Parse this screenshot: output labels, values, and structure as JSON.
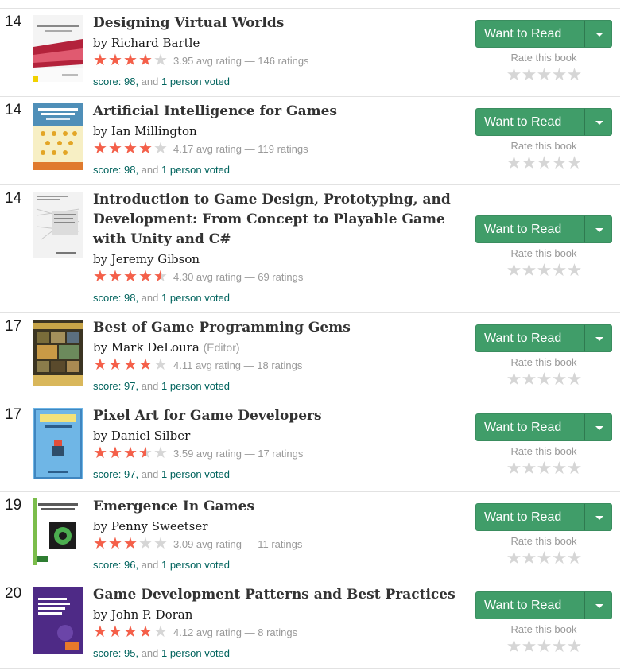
{
  "books": [
    {
      "rank": "14",
      "title": "Designing Virtual Worlds",
      "author": "Richard Bartle",
      "role": "",
      "stars": 3.95,
      "minirating": "3.95 avg rating — 146 ratings",
      "score_label": "score: 98,",
      "and_label": " and ",
      "voted": "1 person voted",
      "cover": "cover-designing-virtual-worlds"
    },
    {
      "rank": "14",
      "title": "Artificial Intelligence for Games",
      "author": "Ian Millington",
      "role": "",
      "stars": 4.17,
      "minirating": "4.17 avg rating — 119 ratings",
      "score_label": "score: 98,",
      "and_label": " and ",
      "voted": "1 person voted",
      "cover": "cover-artificial-intelligence"
    },
    {
      "rank": "14",
      "title": "Introduction to Game Design, Prototyping, and Development: From Concept to Playable Game with Unity and C#",
      "author": "Jeremy Gibson",
      "role": "",
      "stars": 4.3,
      "minirating": "4.30 avg rating — 69 ratings",
      "score_label": "score: 98,",
      "and_label": " and ",
      "voted": "1 person voted",
      "cover": "cover-intro-game-design"
    },
    {
      "rank": "17",
      "title": "Best of Game Programming Gems",
      "author": "Mark DeLoura",
      "role": "(Editor)",
      "stars": 4.11,
      "minirating": "4.11 avg rating — 18 ratings",
      "score_label": "score: 97,",
      "and_label": " and ",
      "voted": "1 person voted",
      "cover": "cover-game-programming-gems"
    },
    {
      "rank": "17",
      "title": "Pixel Art for Game Developers",
      "author": "Daniel Silber",
      "role": "",
      "stars": 3.59,
      "minirating": "3.59 avg rating — 17 ratings",
      "score_label": "score: 97,",
      "and_label": " and ",
      "voted": "1 person voted",
      "cover": "cover-pixel-art"
    },
    {
      "rank": "19",
      "title": "Emergence In Games",
      "author": "Penny Sweetser",
      "role": "",
      "stars": 3.09,
      "minirating": "3.09 avg rating — 11 ratings",
      "score_label": "score: 96,",
      "and_label": " and ",
      "voted": "1 person voted",
      "cover": "cover-emergence-in-games"
    },
    {
      "rank": "20",
      "title": "Game Development Patterns and Best Practices",
      "author": "John P. Doran",
      "role": "",
      "stars": 4.12,
      "minirating": "4.12 avg rating — 8 ratings",
      "score_label": "score: 95,",
      "and_label": " and ",
      "voted": "1 person voted",
      "cover": "cover-game-dev-patterns"
    }
  ],
  "by_label": "by ",
  "want_to_read_label": "Want to Read",
  "rate_this_book_label": "Rate this book",
  "colors": {
    "accent_green": "#409d69",
    "star_orange": "#f55f49",
    "star_empty": "#d6d6d6",
    "link_teal": "#00635d"
  }
}
